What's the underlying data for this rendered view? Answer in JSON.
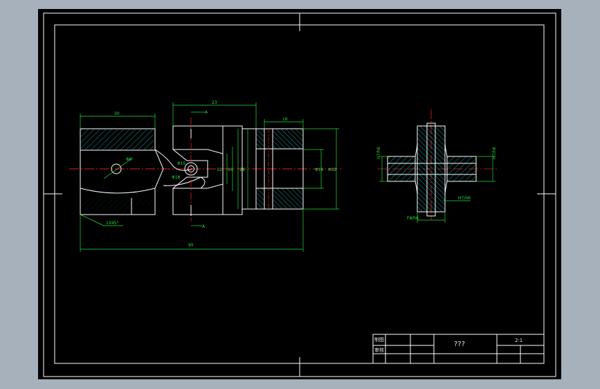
{
  "drawing": {
    "colors": {
      "viewport_bg": "#a7b1bc",
      "sheet_bg": "#000000",
      "outline": "#ffffff",
      "centerline": "#e02020",
      "dimension": "#22e03a",
      "hatch": "#22c8c8"
    },
    "dimensions": {
      "yoke_length": "30",
      "fork_width": "23",
      "hub_width": "16",
      "overall_length": "95",
      "chamfer": "1X45°",
      "pin_dia": "Φ6",
      "bore_dia_a": "Φ15",
      "bore_dia_b": "Φ18",
      "fork_h1": "12",
      "fork_h2": "14",
      "fork_h3": "28",
      "shaft_dia": "Φ18",
      "outer_dia": "Φ22",
      "section_mark": "A",
      "fit_left": "H7/h6",
      "fit_right": "H7/h6",
      "fit_bottom": "H7/h6",
      "fit_lower": "F8/h6"
    },
    "title_block": {
      "cell_a": "制图",
      "cell_b": "审核",
      "name": "???",
      "scale": "2:1"
    }
  }
}
